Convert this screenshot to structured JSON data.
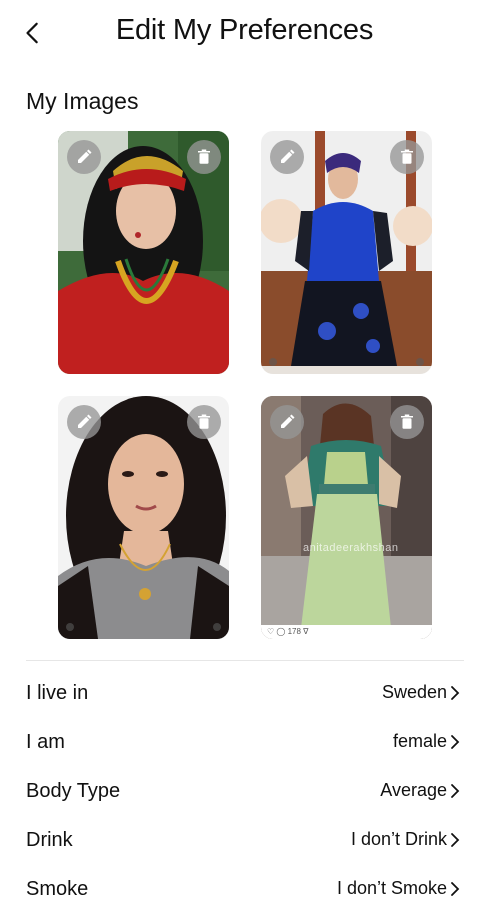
{
  "header": {
    "title": "Edit My Preferences",
    "back_icon": "chevron-left-icon"
  },
  "images_section": {
    "title": "My Images",
    "photos": [
      {
        "edit_icon": "pencil-icon",
        "delete_icon": "trash-icon"
      },
      {
        "edit_icon": "pencil-icon",
        "delete_icon": "trash-icon"
      },
      {
        "edit_icon": "pencil-icon",
        "delete_icon": "trash-icon"
      },
      {
        "edit_icon": "pencil-icon",
        "delete_icon": "trash-icon",
        "watermark": "anitadeerakhshan",
        "social_text": "♡ ◯ 178 ∇"
      }
    ]
  },
  "preferences": [
    {
      "label": "I live in",
      "value": "Sweden"
    },
    {
      "label": "I am",
      "value": "female"
    },
    {
      "label": "Body Type",
      "value": "Average"
    },
    {
      "label": "Drink",
      "value": "I don’t Drink"
    },
    {
      "label": "Smoke",
      "value": "I don’t Smoke"
    }
  ],
  "colors": {
    "text": "#111111",
    "button_overlay": "#969696",
    "divider": "#e6e6e6"
  }
}
